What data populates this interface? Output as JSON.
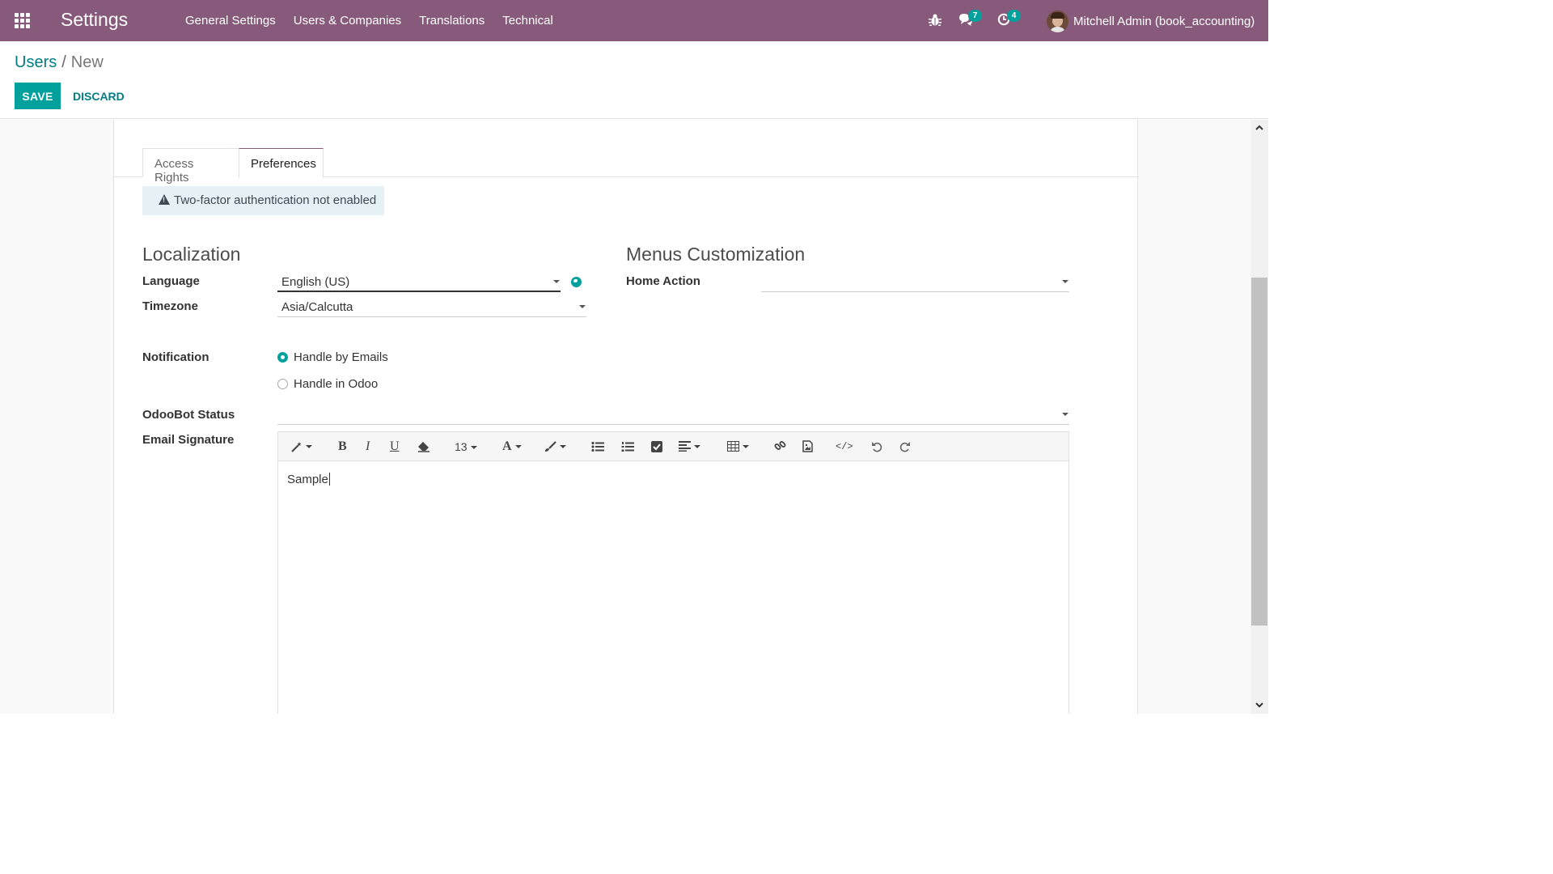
{
  "navbar": {
    "brand": "Settings",
    "menu": [
      "General Settings",
      "Users & Companies",
      "Translations",
      "Technical"
    ],
    "messages_count": "7",
    "activities_count": "4",
    "user_name": "Mitchell Admin (book_accounting)"
  },
  "breadcrumb": {
    "parent": "Users",
    "separator": "/",
    "current": "New"
  },
  "actions": {
    "save": "SAVE",
    "discard": "DISCARD"
  },
  "tabs": [
    "Access Rights",
    "Preferences"
  ],
  "active_tab": "Preferences",
  "alert": "Two-factor authentication not enabled",
  "localization": {
    "title": "Localization",
    "language_label": "Language",
    "language_value": "English (US)",
    "timezone_label": "Timezone",
    "timezone_value": "Asia/Calcutta"
  },
  "menus": {
    "title": "Menus Customization",
    "home_action_label": "Home Action",
    "home_action_value": ""
  },
  "notification": {
    "label": "Notification",
    "options": [
      "Handle by Emails",
      "Handle in Odoo"
    ],
    "selected": "Handle by Emails"
  },
  "odoobot": {
    "label": "OdooBot Status",
    "value": ""
  },
  "signature": {
    "label": "Email Signature",
    "font_size": "13",
    "content": "Sample"
  },
  "colors": {
    "navbar": "#875a7b",
    "primary": "#00a09d",
    "link": "#017e84"
  }
}
